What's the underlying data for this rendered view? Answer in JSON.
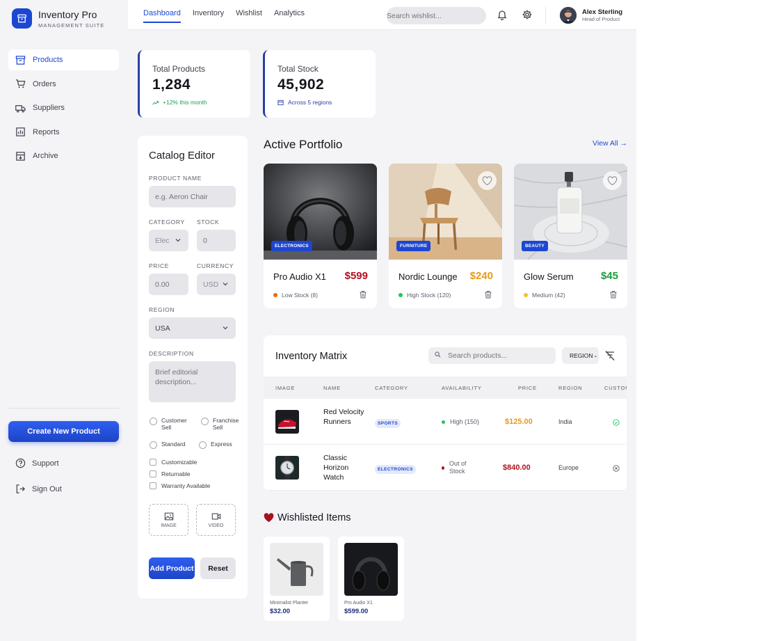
{
  "brand": {
    "title": "Inventory Pro",
    "subtitle": "MANAGEMENT SUITE"
  },
  "sidebar": {
    "items": [
      {
        "label": "Products",
        "icon": "archive-box-icon",
        "active": true
      },
      {
        "label": "Orders",
        "icon": "cart-icon",
        "active": false
      },
      {
        "label": "Suppliers",
        "icon": "truck-icon",
        "active": false
      },
      {
        "label": "Reports",
        "icon": "bar-chart-icon",
        "active": false
      },
      {
        "label": "Archive",
        "icon": "archive-download-icon",
        "active": false
      }
    ],
    "create_label": "Create New Product",
    "support_label": "Support",
    "signout_label": "Sign Out"
  },
  "topbar": {
    "tabs": [
      "Dashboard",
      "Inventory",
      "Wishlist",
      "Analytics"
    ],
    "active_tab": "Dashboard",
    "search_placeholder": "Search wishlist...",
    "user_name": "Alex Sterling",
    "user_role": "Head of Product"
  },
  "stats": [
    {
      "label": "Total Products",
      "value": "1,284",
      "sub": "+12% this month",
      "sub_color": "#1f9d55"
    },
    {
      "label": "Total Stock",
      "value": "45,902",
      "sub": "Across 5 regions",
      "sub_color": "#2a3fa6"
    }
  ],
  "editor": {
    "title": "Catalog Editor",
    "product_name_label": "PRODUCT NAME",
    "product_name_placeholder": "e.g. Aeron Chair",
    "category_label": "CATEGORY",
    "category_value": "Elec",
    "stock_label": "STOCK",
    "stock_placeholder": "0",
    "price_label": "PRICE",
    "price_placeholder": "0.00",
    "currency_label": "CURRENCY",
    "currency_value": "USD",
    "region_label": "REGION",
    "region_value": "USA",
    "description_label": "DESCRIPTION",
    "description_placeholder": "Brief editorial description...",
    "radios": [
      "Customer Sell",
      "Franchise Sell",
      "Standard",
      "Express"
    ],
    "checks": [
      "Customizable",
      "Returnable",
      "Warranty Available"
    ],
    "upload_image": "IMAGE",
    "upload_video": "VIDEO",
    "add_label": "Add Product",
    "reset_label": "Reset"
  },
  "portfolio": {
    "title": "Active Portfolio",
    "view_all": "View All",
    "cards": [
      {
        "name": "Pro Audio X1",
        "price": "$599",
        "price_color": "#b3111e",
        "tag": "ELECTRONICS",
        "stock": "Low Stock (8)",
        "stock_color": "#ea6a10",
        "favorite": false
      },
      {
        "name": "Nordic Lounge",
        "price": "$240",
        "price_color": "#ea9a17",
        "tag": "FURNITURE",
        "stock": "High Stock (120)",
        "stock_color": "#22c55e",
        "favorite": true
      },
      {
        "name": "Glow Serum",
        "price": "$45",
        "price_color": "#1f9d3d",
        "tag": "BEAUTY",
        "stock": "Medium (42)",
        "stock_color": "#f2c12e",
        "favorite": true
      }
    ]
  },
  "matrix": {
    "title": "Inventory Matrix",
    "search_placeholder": "Search products...",
    "region_filter": "REGION",
    "headers": [
      "IMAGE",
      "NAME",
      "CATEGORY",
      "AVAILABILITY",
      "PRICE",
      "REGION",
      "CUSTOM"
    ],
    "rows": [
      {
        "name": "Red Velocity Runners",
        "category": "SPORTS",
        "availability": "High (150)",
        "avail_color": "#22c55e",
        "price": "$125.00",
        "price_color": "#ea9a17",
        "region": "India",
        "customizable": true
      },
      {
        "name": "Classic Horizon Watch",
        "category": "ELECTRONICS",
        "availability": "Out of Stock",
        "avail_color": "#b3111e",
        "price": "$840.00",
        "price_color": "#b3111e",
        "region": "Europe",
        "customizable": false
      }
    ]
  },
  "wishlist": {
    "title": "Wishlisted Items",
    "items": [
      {
        "name": "Minimalist Planter",
        "price": "$32.00"
      },
      {
        "name": "Pro Audio X1",
        "price": "$599.00"
      }
    ]
  },
  "colors": {
    "accent": "#1d47d2",
    "background": "#f4f4f7"
  }
}
